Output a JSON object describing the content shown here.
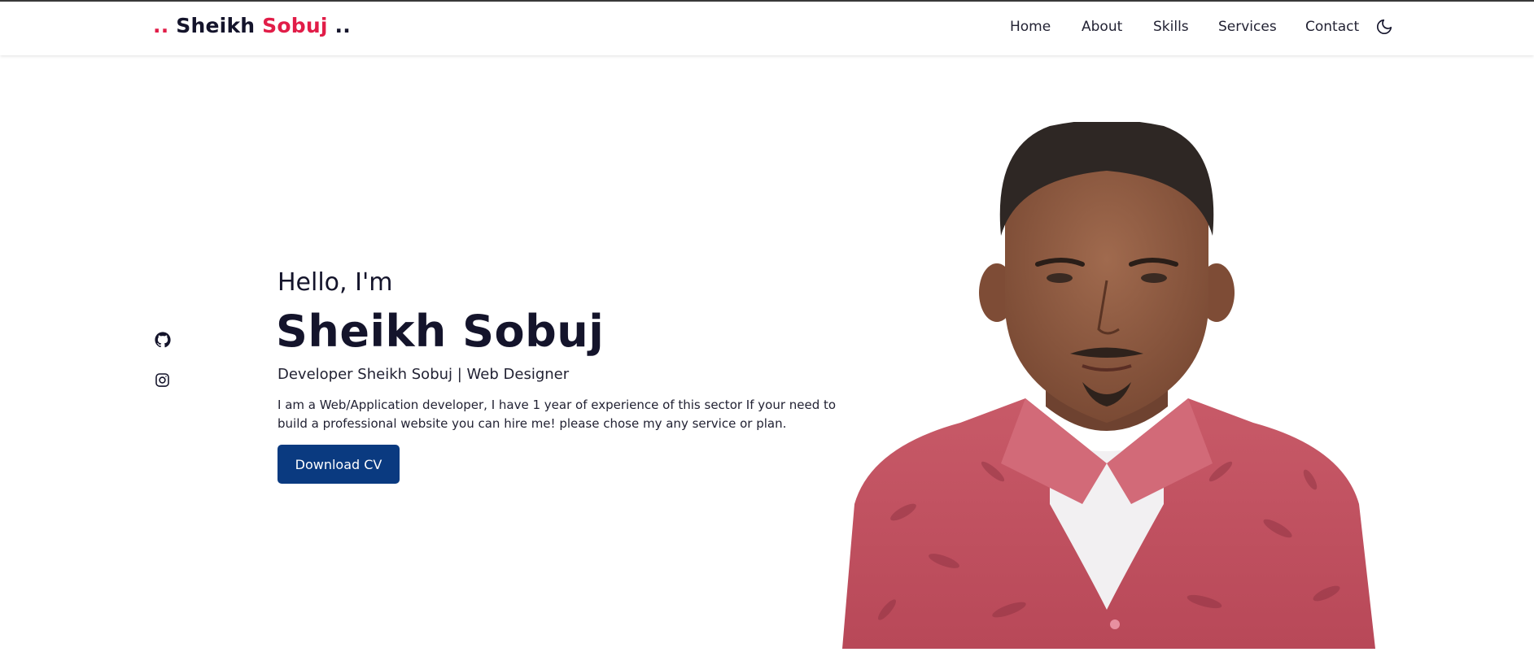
{
  "header": {
    "logo": {
      "prefix": "..",
      "first": " Sheikh ",
      "last": "Sobuj",
      "suffix": " .."
    },
    "nav": [
      "Home",
      "About",
      "Skills",
      "Services",
      "Contact"
    ],
    "theme_toggle_icon": "moon-icon"
  },
  "social": {
    "icons": [
      "github-icon",
      "instagram-icon"
    ]
  },
  "hero": {
    "greeting": "Hello, I'm",
    "name": "Sheikh Sobuj",
    "title": "Developer Sheikh Sobuj | Web Designer",
    "description": "I am a Web/Application developer, I have 1 year of experience of this sector If your need to build a professional website you can hire me! please chose my any service or plan.",
    "cta_label": "Download CV"
  },
  "colors": {
    "accent": "#e11d48",
    "primary_button": "#0a3a80",
    "text_dark": "#14142b"
  }
}
